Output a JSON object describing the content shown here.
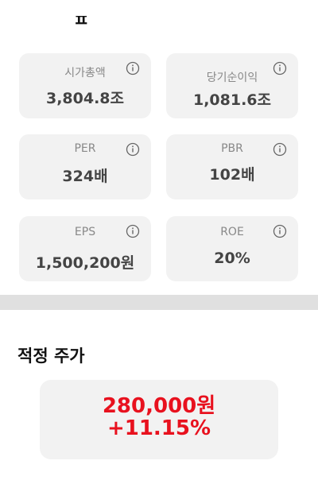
{
  "header": {
    "partial_title": "ㅍ"
  },
  "metrics": [
    {
      "label": "시가총액",
      "value": "3,804.8조"
    },
    {
      "label": "당기순이익",
      "value": "1,081.6조"
    },
    {
      "label": "PER",
      "value": "324배"
    },
    {
      "label": "PBR",
      "value": "102배"
    },
    {
      "label": "EPS",
      "value": "1,500,200원"
    },
    {
      "label": "ROE",
      "value": "20%"
    }
  ],
  "fair_price": {
    "title": "적정 주가",
    "price": "280,000원",
    "change": "+11.15%"
  },
  "colors": {
    "accent_red": "#e8111e",
    "card_bg": "#f2f2f2",
    "divider": "#e0e0e0"
  },
  "icons": {
    "info": "info-circle-icon"
  }
}
